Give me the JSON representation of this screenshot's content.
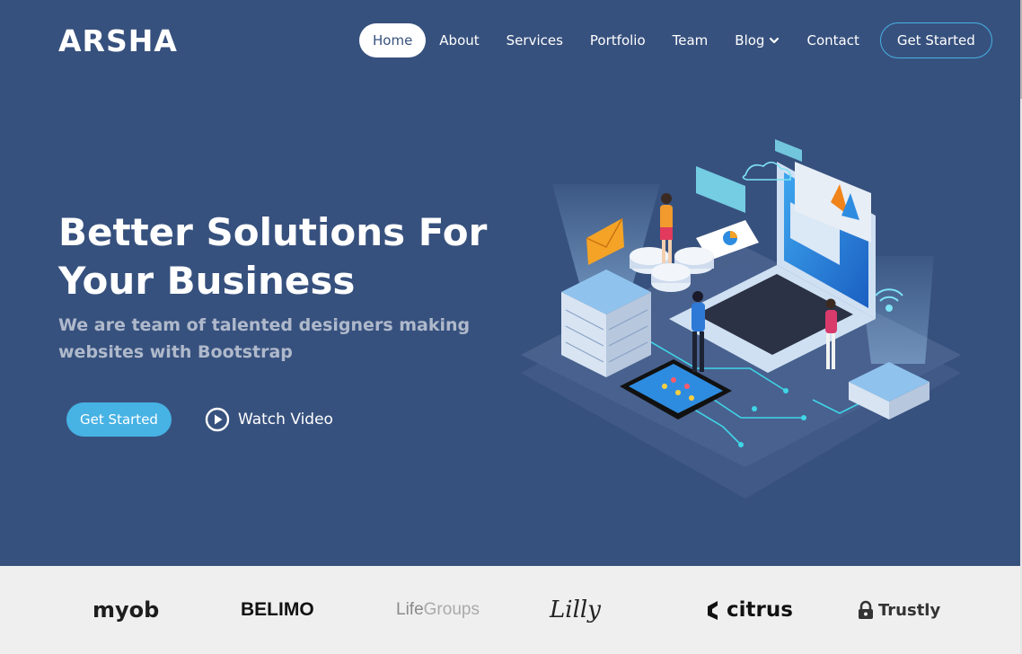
{
  "brand": {
    "logo": "ARSHA"
  },
  "nav": {
    "items": [
      "Home",
      "About",
      "Services",
      "Portfolio",
      "Team",
      "Blog",
      "Contact"
    ],
    "active": "Home",
    "cta": "Get Started"
  },
  "hero": {
    "title_line1": "Better Solutions For",
    "title_line2": "Your Business",
    "subtitle": "We are team of talented designers making websites with Bootstrap",
    "get_started": "Get Started",
    "watch_video": "Watch Video"
  },
  "clients": {
    "myob": "myob",
    "belimo": "BELIMO",
    "lifegroups_a": "Life",
    "lifegroups_b": "Groups",
    "lilly": "Lilly",
    "citrus": "citrus",
    "trustly": "Trustly"
  },
  "colors": {
    "background": "#37517e",
    "accent": "#47b2e4",
    "clients_bg": "#efefef"
  },
  "icons": [
    "chevron-down-icon",
    "play-circle-icon"
  ]
}
